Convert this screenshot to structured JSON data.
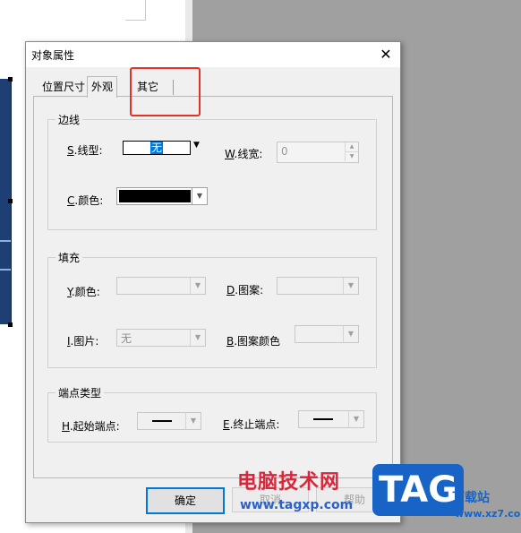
{
  "dialog": {
    "title": "对象属性",
    "close_symbol": "✕",
    "tabs": [
      {
        "label": "位置尺寸"
      },
      {
        "label": "外观"
      },
      {
        "label": "其它"
      }
    ],
    "border_group": {
      "legend": "边线",
      "line_type": {
        "key": "S",
        "label": ".线型:",
        "value": "无"
      },
      "line_width": {
        "key": "W",
        "label": ".线宽:",
        "value": "0"
      },
      "color": {
        "key": "C",
        "label": ".颜色:",
        "value_color": "#000000"
      }
    },
    "fill_group": {
      "legend": "填充",
      "y_color": {
        "key": "Y",
        "label": ".颜色:"
      },
      "pattern": {
        "key": "D",
        "label": ".图案:"
      },
      "image": {
        "key": "I",
        "label": ".图片:",
        "value": "无"
      },
      "pattern_color": {
        "key": "B",
        "label": ".图案颜色"
      }
    },
    "endpoint_group": {
      "legend": "端点类型",
      "start": {
        "key": "H",
        "label": ".起始端点:"
      },
      "end": {
        "key": "E",
        "label": ".终止端点:"
      }
    },
    "buttons": {
      "ok": "确定",
      "cancel": "取消",
      "help": "帮助"
    }
  },
  "watermark": {
    "text": "电脑技术网",
    "url": "www.tagxp.com",
    "badge": "TAG",
    "site": "下载站",
    "site_url": "www.xz7.com"
  },
  "colors": {
    "highlight": "#e0322a",
    "accent": "#0078d7",
    "badge_blue": "#1763c6"
  }
}
